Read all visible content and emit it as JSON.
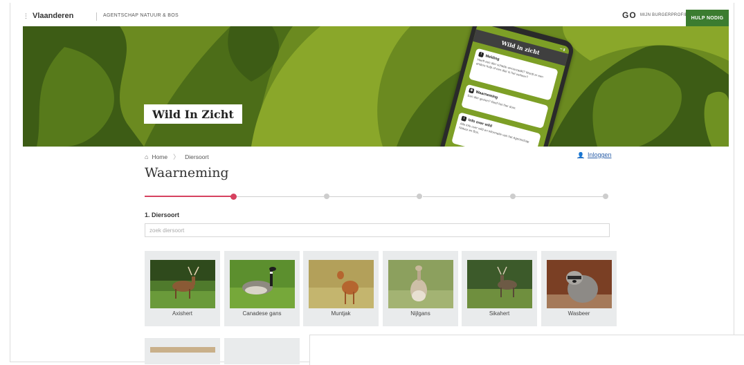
{
  "topbar": {
    "brand": "Vlaanderen",
    "org": "AGENTSCHAP NATUUR & BOS",
    "burgerprofiel_icon": "GO",
    "burgerprofiel_label": "MIJN BURGERPROFIEL",
    "help_label": "HULP NODIG"
  },
  "hero": {
    "title": "Wild In Zicht",
    "phone": {
      "header": "Wild in zicht",
      "cards": [
        {
          "title": "Melding",
          "text": "Heeft een dier schade veroorzaakt? Wordt er een andere hulp of een dier in het verkeer?"
        },
        {
          "title": "Waarneming",
          "text": "Een dier gezien? Geef het hier door."
        },
        {
          "title": "Info over wild",
          "text": "Alle info over wild en informatie van het Agentschap Natuur en Bos."
        }
      ]
    }
  },
  "breadcrumb": {
    "home": "Home",
    "current": "Diersoort"
  },
  "login_label": "Inloggen",
  "page_title": "Waarneming",
  "stepper": {
    "total_steps": 6,
    "current_step": 1
  },
  "step_label": "1. Diersoort",
  "search": {
    "placeholder": "zoek diersoort"
  },
  "animals": [
    {
      "name": "Axishert",
      "icon": "deer-photo"
    },
    {
      "name": "Canadese gans",
      "icon": "goose-photo"
    },
    {
      "name": "Muntjak",
      "icon": "muntjac-photo"
    },
    {
      "name": "Nijlgans",
      "icon": "egyptian-goose-photo"
    },
    {
      "name": "Sikahert",
      "icon": "sika-deer-photo"
    },
    {
      "name": "Wasbeer",
      "icon": "raccoon-photo"
    }
  ],
  "colors": {
    "hero_dark": "#3c5a14",
    "hero_light": "#8aa72a",
    "accent": "#d6415f",
    "link": "#2b5fa8",
    "help_button": "#3b7c30"
  }
}
